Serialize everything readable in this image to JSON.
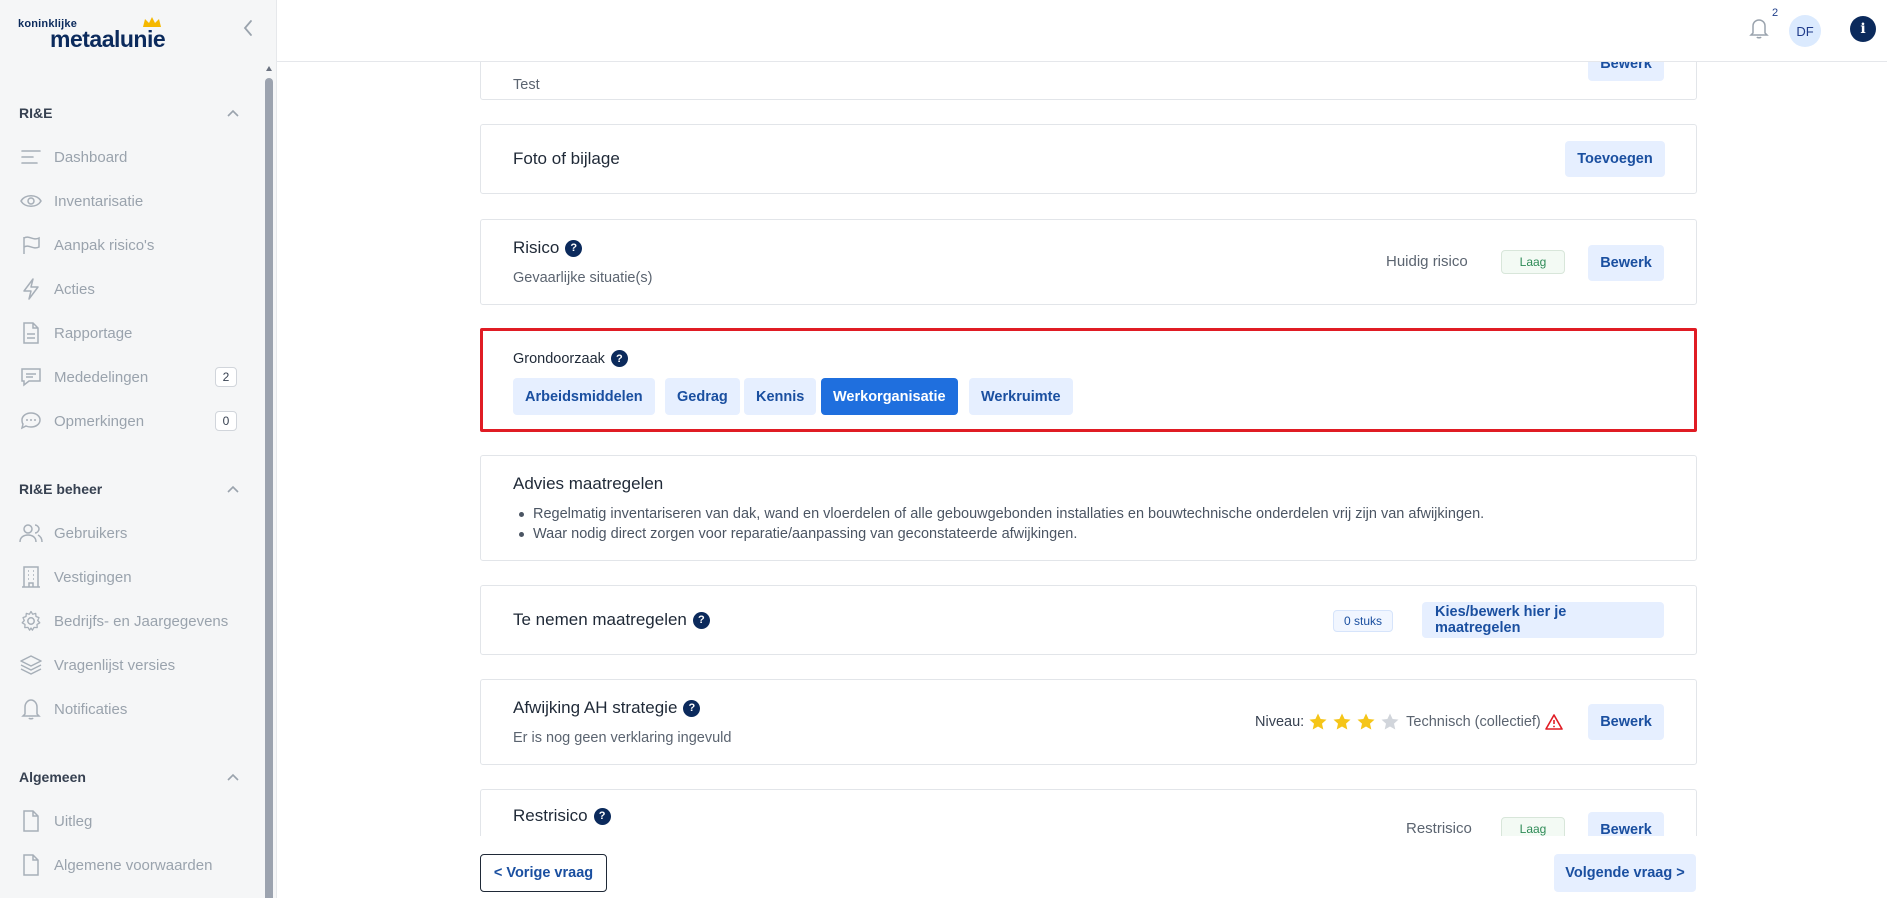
{
  "brand": {
    "logo_small": "koninklijke",
    "logo_big": "metaalunie"
  },
  "sidebar": {
    "sections": [
      {
        "title": "RI&E",
        "items": [
          {
            "label": "Dashboard",
            "icon": "dashboard-lines-icon"
          },
          {
            "label": "Inventarisatie",
            "icon": "eye-icon"
          },
          {
            "label": "Aanpak risico's",
            "icon": "flag-icon"
          },
          {
            "label": "Acties",
            "icon": "lightning-icon"
          },
          {
            "label": "Rapportage",
            "icon": "document-icon"
          },
          {
            "label": "Mededelingen",
            "icon": "message-icon",
            "badge": "2"
          },
          {
            "label": "Opmerkingen",
            "icon": "chat-bubble-icon",
            "badge": "0"
          }
        ]
      },
      {
        "title": "RI&E beheer",
        "items": [
          {
            "label": "Gebruikers",
            "icon": "users-icon"
          },
          {
            "label": "Vestigingen",
            "icon": "building-icon"
          },
          {
            "label": "Bedrijfs- en Jaargegevens",
            "icon": "gear-icon"
          },
          {
            "label": "Vragenlijst versies",
            "icon": "layers-icon"
          },
          {
            "label": "Notificaties",
            "icon": "bell-icon"
          }
        ]
      },
      {
        "title": "Algemeen",
        "items": [
          {
            "label": "Uitleg",
            "icon": "document-icon"
          },
          {
            "label": "Algemene voorwaarden",
            "icon": "document-icon"
          }
        ]
      }
    ]
  },
  "topbar": {
    "notification_count": "2",
    "avatar_initials": "DF",
    "info_label": "i"
  },
  "cards": {
    "top": {
      "text": "Test",
      "button": "Bewerk"
    },
    "foto": {
      "title": "Foto of bijlage",
      "button": "Toevoegen"
    },
    "risico": {
      "title": "Risico",
      "subtitle": "Gevaarlijke situatie(s)",
      "current_label": "Huidig risico",
      "level": "Laag",
      "button": "Bewerk"
    },
    "grondoorzaak": {
      "title": "Grondoorzaak",
      "options": [
        "Arbeidsmiddelen",
        "Gedrag",
        "Kennis",
        "Werkorganisatie",
        "Werkruimte"
      ],
      "selected": "Werkorganisatie"
    },
    "advies": {
      "title": "Advies maatregelen",
      "items": [
        "Regelmatig inventariseren van dak, wand en vloerdelen of alle gebouwgebonden installaties en bouwtechnische onderdelen vrij zijn van afwijkingen.",
        "Waar nodig direct zorgen voor reparatie/aanpassing van geconstateerde afwijkingen."
      ]
    },
    "maatregelen": {
      "title": "Te nemen maatregelen",
      "count": "0 stuks",
      "button": "Kies/bewerk hier je maatregelen"
    },
    "afwijking": {
      "title": "Afwijking AH strategie",
      "subtitle": "Er is nog geen verklaring ingevuld",
      "niveau_label": "Niveau:",
      "stars_filled": 3,
      "stars_total": 4,
      "type": "Technisch (collectief)",
      "button": "Bewerk"
    },
    "restrisico": {
      "title": "Restrisico",
      "label": "Restrisico",
      "level": "Laag",
      "button": "Bewerk"
    }
  },
  "footer": {
    "prev": "< Vorige vraag",
    "next": "Volgende vraag >"
  },
  "colors": {
    "primary": "#1f6fde",
    "navy": "#0b2a5c",
    "soft": "#e6efff",
    "highlight": "#e01c24",
    "gold": "#f5c518"
  }
}
